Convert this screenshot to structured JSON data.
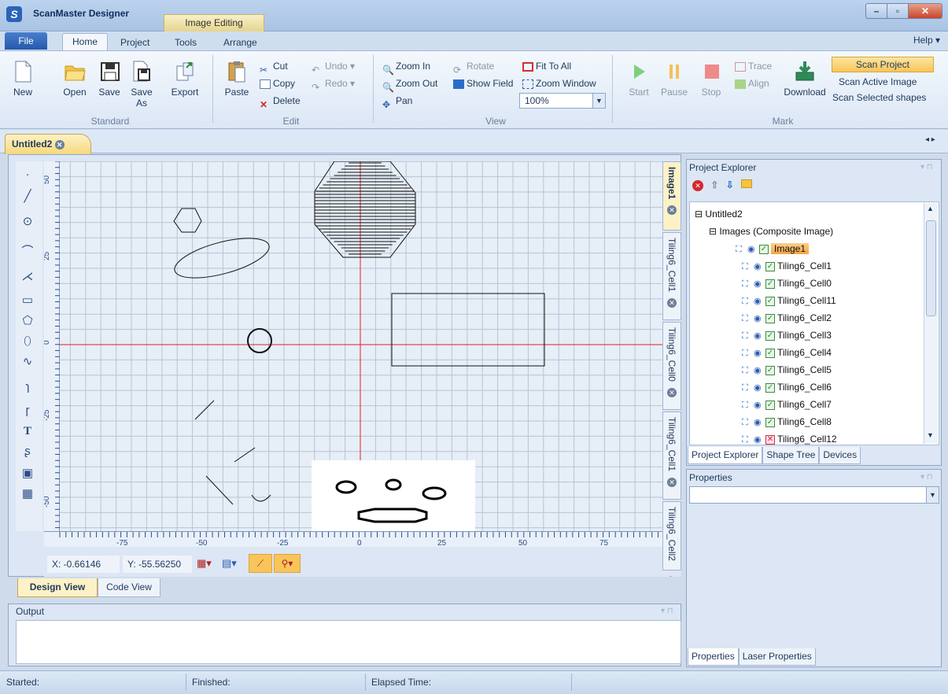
{
  "window": {
    "app_title": "ScanMaster Designer",
    "context_tab": "Image Editing",
    "minimize": "–",
    "maximize": "▫",
    "close": "✕"
  },
  "ribbon": {
    "file_tab": "File",
    "tabs": [
      "Home",
      "Project",
      "Tools",
      "Arrange"
    ],
    "help": "Help ▾",
    "standard": {
      "new": "New",
      "open": "Open",
      "save": "Save",
      "save_as": "Save As",
      "export": "Export",
      "group": "Standard"
    },
    "edit": {
      "paste": "Paste",
      "cut": "Cut",
      "copy": "Copy",
      "delete": "Delete",
      "undo": "Undo",
      "redo": "Redo",
      "group": "Edit"
    },
    "view": {
      "zoom_in": "Zoom In",
      "zoom_out": "Zoom Out",
      "pan": "Pan",
      "rotate": "Rotate",
      "show_field": "Show Field",
      "fit_to_all": "Fit To All",
      "zoom_window": "Zoom Window",
      "zoom_value": "100%",
      "group": "View"
    },
    "mark": {
      "start": "Start",
      "pause": "Pause",
      "stop": "Stop",
      "trace": "Trace",
      "align": "Align",
      "download": "Download",
      "scan_project": "Scan Project",
      "scan_active_image": "Scan Active Image",
      "scan_selected_shapes": "Scan Selected shapes",
      "group": "Mark"
    }
  },
  "document": {
    "tab": "Untitled2"
  },
  "rulers": {
    "vertical_labels": [
      "50",
      "25",
      "0",
      "-25",
      "-50"
    ],
    "horizontal_labels": [
      "-75",
      "-50",
      "-25",
      "0",
      "25",
      "50",
      "75"
    ]
  },
  "coords": {
    "x": "X:  -0.66146",
    "y": "Y:  -55.56250"
  },
  "view_tabs": {
    "design": "Design View",
    "code": "Code View"
  },
  "side_tabs": [
    "Image1",
    "Tiling6_Cell1",
    "Tiling6_Cell0",
    "Tiling6_Cell1",
    "Tiling6_Cell2"
  ],
  "output": {
    "title": "Output"
  },
  "project_explorer": {
    "title": "Project Explorer",
    "root": "Untitled2",
    "images_node": "Images (Composite Image)",
    "items": [
      {
        "label": "Image1",
        "selected": true,
        "checked": true
      },
      {
        "label": "Tiling6_Cell1",
        "checked": true
      },
      {
        "label": "Tiling6_Cell0",
        "checked": true
      },
      {
        "label": "Tiling6_Cell11",
        "checked": true
      },
      {
        "label": "Tiling6_Cell2",
        "checked": true
      },
      {
        "label": "Tiling6_Cell3",
        "checked": true
      },
      {
        "label": "Tiling6_Cell4",
        "checked": true
      },
      {
        "label": "Tiling6_Cell5",
        "checked": true
      },
      {
        "label": "Tiling6_Cell6",
        "checked": true
      },
      {
        "label": "Tiling6_Cell7",
        "checked": true
      },
      {
        "label": "Tiling6_Cell8",
        "checked": true
      },
      {
        "label": "Tiling6_Cell12",
        "checked": false
      }
    ],
    "tabs": [
      "Project Explorer",
      "Shape Tree",
      "Devices"
    ]
  },
  "properties": {
    "title": "Properties",
    "tabs": [
      "Properties",
      "Laser Properties"
    ]
  },
  "status": {
    "started": "Started:",
    "finished": "Finished:",
    "elapsed": "Elapsed Time:"
  },
  "colors": {
    "accent": "#f5a43d",
    "axis": "#e02020",
    "ribbon": "#dbe7f5"
  }
}
